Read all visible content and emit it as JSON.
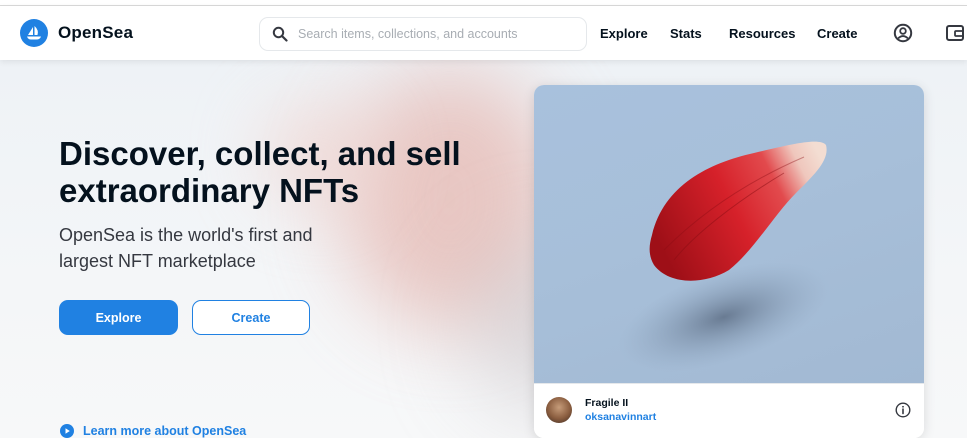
{
  "brand": {
    "name": "OpenSea",
    "color": "#2081e2"
  },
  "search": {
    "placeholder": "Search items, collections, and accounts",
    "icon": "search-icon"
  },
  "nav": {
    "explore": "Explore",
    "stats": "Stats",
    "resources": "Resources",
    "create": "Create",
    "icons": [
      "profile-icon",
      "wallet-icon"
    ]
  },
  "hero": {
    "headline_line1": "Discover, collect, and sell",
    "headline_line2": "extraordinary NFTs",
    "subhead_line1": "OpenSea is the world's first and",
    "subhead_line2": "largest NFT marketplace",
    "explore_label": "Explore",
    "create_label": "Create",
    "learn_more": "Learn more about OpenSea"
  },
  "featured": {
    "name": "Fragile II",
    "creator": "oksanavinnart"
  }
}
